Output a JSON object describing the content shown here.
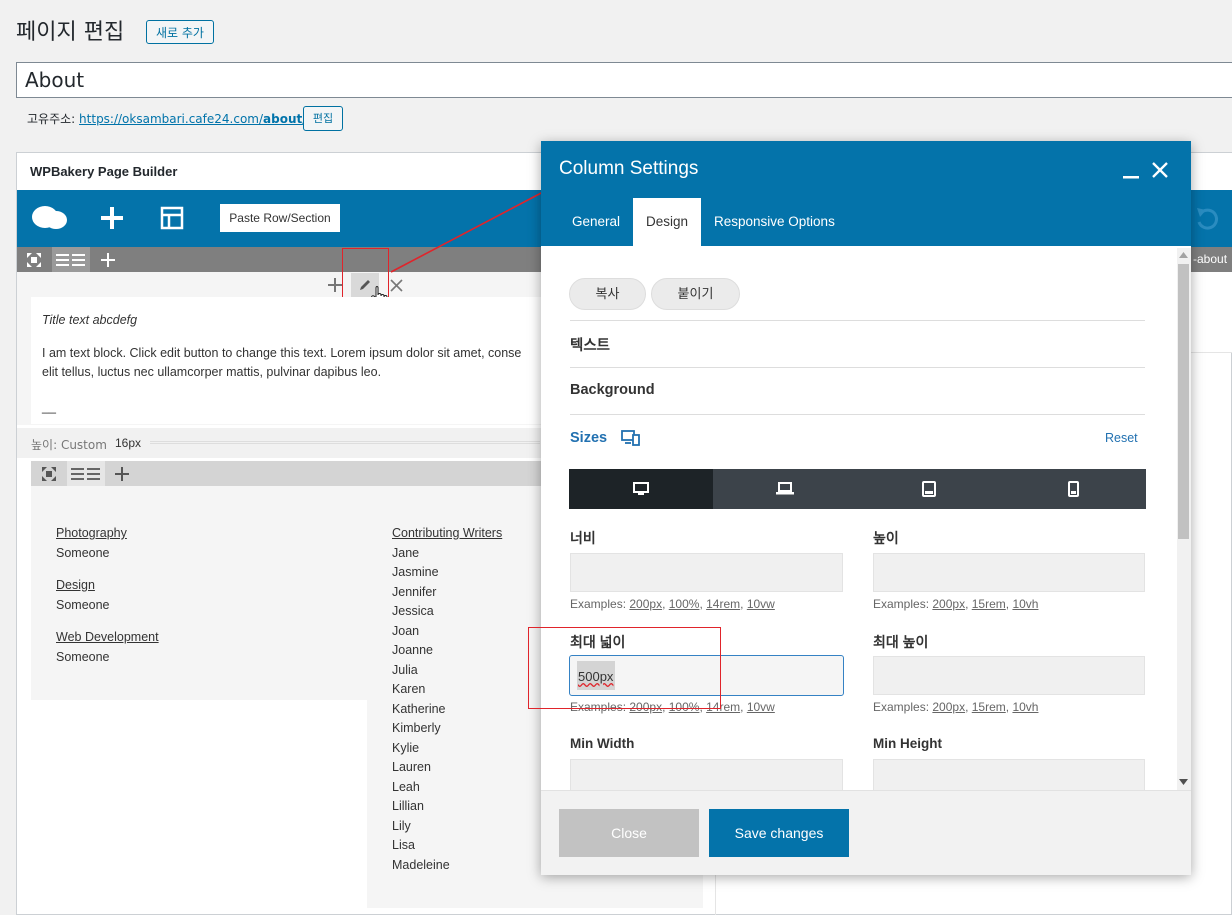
{
  "page": {
    "title": "페이지 편집",
    "add_new": "새로 추가",
    "post_title": "About",
    "permalink_label": "고유주소:",
    "permalink_url_base": "https://oksambari.cafe24.com/",
    "permalink_slug": "about",
    "permalink_suffix": "/",
    "edit_btn": "편집"
  },
  "builder": {
    "title": "WPBakery Page Builder",
    "paste_btn": "Paste Row/Section",
    "right_tag": "-about",
    "text_title": "Title text abcdefg",
    "text_body_1": "I am text block. Click edit button to change this text. Lorem ipsum dolor sit amet, conse",
    "text_body_2": "elit tellus, luctus nec ullamcorper mattis, pulvinar dapibus leo.",
    "text_end": "__",
    "spacer_label": "높이: Custom",
    "spacer_value": "16px",
    "left_items": [
      {
        "link": "Photography",
        "value": "Someone"
      },
      {
        "link": "Design",
        "value": "Someone"
      },
      {
        "link": "Web Development",
        "value": "Someone"
      }
    ],
    "writers_title": "Contributing Writers",
    "writers": [
      "Jane",
      "Jasmine",
      "Jennifer",
      "Jessica",
      "Joan",
      "Joanne",
      "Julia",
      "Karen",
      "Katherine",
      "Kimberly",
      "Kylie",
      "Lauren",
      "Leah",
      "Lillian",
      "Lily",
      "Lisa",
      "Madeleine"
    ]
  },
  "modal": {
    "title": "Column Settings",
    "tabs": [
      "General",
      "Design",
      "Responsive Options"
    ],
    "copy_btn": "복사",
    "paste_btn": "붙이기",
    "section_text": "텍스트",
    "section_background": "Background",
    "section_sizes": "Sizes",
    "reset": "Reset",
    "width_label": "너비",
    "height_label": "높이",
    "max_width_label": "최대 넓이",
    "max_height_label": "최대 높이",
    "min_width_label": "Min Width",
    "min_height_label": "Min Height",
    "max_width_value": "500px",
    "examples_prefix": "Examples:",
    "ex_width": [
      "200px",
      "100%",
      "14rem",
      "10vw"
    ],
    "ex_height": [
      "200px",
      "15rem",
      "10vh"
    ],
    "close_btn": "Close",
    "save_btn": "Save changes"
  }
}
